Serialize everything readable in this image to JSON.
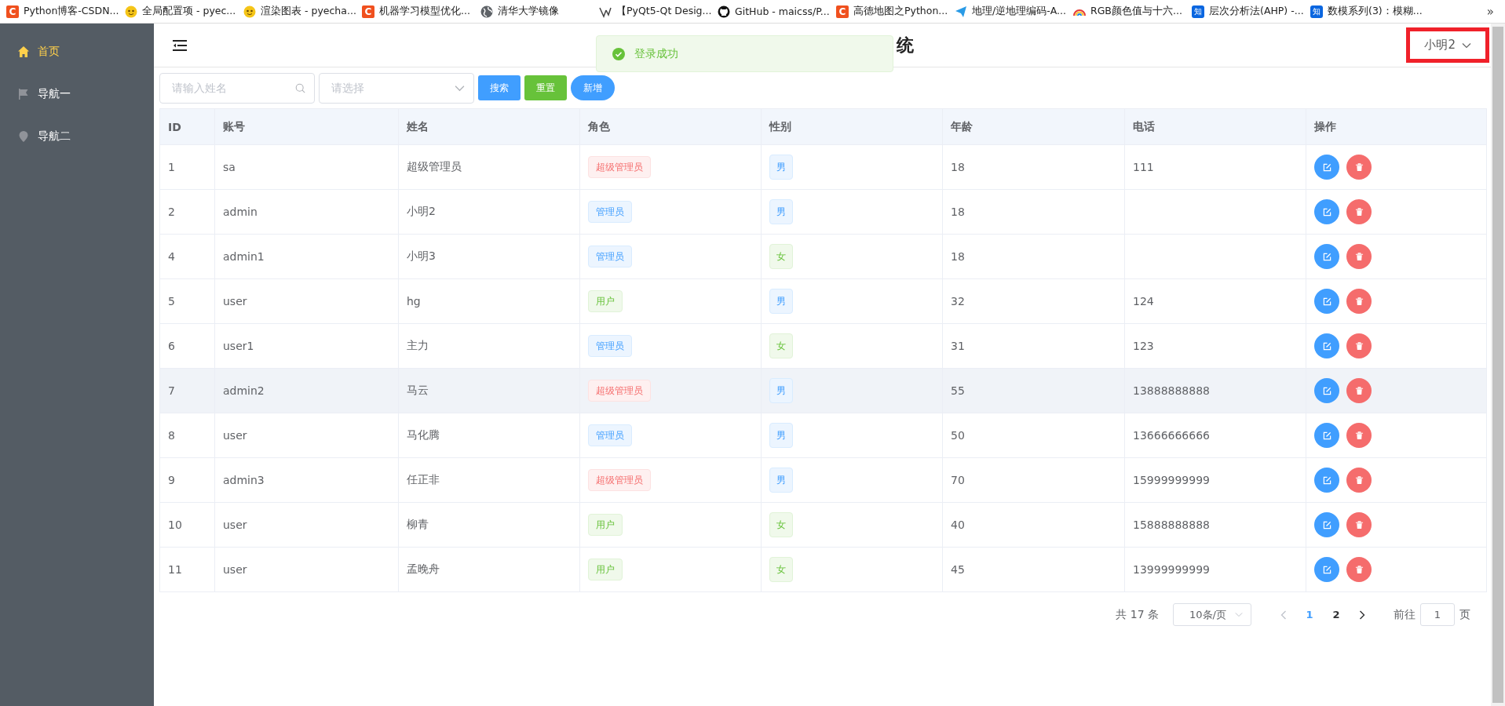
{
  "bookmarks": [
    {
      "kind": "letter",
      "icon_text": "C",
      "label": "Python博客-CSDN..."
    },
    {
      "kind": "smiley",
      "label": "全局配置项 - pyec..."
    },
    {
      "kind": "smiley",
      "label": "渲染图表 - pyecha..."
    },
    {
      "kind": "letter",
      "icon_text": "C",
      "label": "机器学习模型优化..."
    },
    {
      "kind": "globe",
      "label": "清华大学镜像"
    },
    {
      "kind": "mark",
      "label": "【PyQt5-Qt Desig..."
    },
    {
      "kind": "cat",
      "label": "GitHub - maicss/P..."
    },
    {
      "kind": "letter",
      "icon_text": "C",
      "label": "高德地图之Python..."
    },
    {
      "kind": "plane",
      "label": "地理/逆地理编码-A..."
    },
    {
      "kind": "rainbow",
      "label": "RGB颜色值与十六..."
    },
    {
      "kind": "square",
      "icon_text": "知",
      "label": "层次分析法(AHP) -..."
    },
    {
      "kind": "square",
      "icon_text": "知",
      "label": "数模系列(3)：模糊..."
    }
  ],
  "bookmarks_more": "»",
  "sidebar": {
    "items": [
      {
        "kind": "home",
        "label": "首页",
        "selected": true
      },
      {
        "kind": "flag",
        "label": "导航一",
        "selected": false
      },
      {
        "kind": "pin",
        "label": "导航二",
        "selected": false
      }
    ]
  },
  "header": {
    "title": "统",
    "user_menu": "小明2"
  },
  "toast": {
    "message": "登录成功"
  },
  "toolbar": {
    "search_placeholder": "请输入姓名",
    "select_placeholder": "请选择",
    "buttons": [
      {
        "label": "搜索",
        "kind": "primary"
      },
      {
        "label": "重置",
        "kind": "success"
      },
      {
        "label": "新增",
        "kind": "round"
      }
    ]
  },
  "table": {
    "columns": [
      "ID",
      "账号",
      "姓名",
      "角色",
      "性别",
      "年龄",
      "电话",
      "操作"
    ],
    "rows": [
      {
        "id": "1",
        "account": "sa",
        "name": "超级管理员",
        "role": {
          "text": "超级管理员",
          "kind": "danger"
        },
        "gender": {
          "text": "男",
          "kind": "primary"
        },
        "age": "18",
        "phone": "111",
        "highlighted": false
      },
      {
        "id": "2",
        "account": "admin",
        "name": "小明2",
        "role": {
          "text": "管理员",
          "kind": "primary"
        },
        "gender": {
          "text": "男",
          "kind": "primary"
        },
        "age": "18",
        "highlighted": false
      },
      {
        "id": "4",
        "account": "admin1",
        "name": "小明3",
        "role": {
          "text": "管理员",
          "kind": "primary"
        },
        "gender": {
          "text": "女",
          "kind": "success"
        },
        "age": "18",
        "highlighted": false
      },
      {
        "id": "5",
        "account": "user",
        "name": "hg",
        "role": {
          "text": "用户",
          "kind": "success"
        },
        "gender": {
          "text": "男",
          "kind": "primary"
        },
        "age": "32",
        "phone": "124",
        "highlighted": false
      },
      {
        "id": "6",
        "account": "user1",
        "name": "主力",
        "role": {
          "text": "管理员",
          "kind": "primary"
        },
        "gender": {
          "text": "女",
          "kind": "success"
        },
        "age": "31",
        "phone": "123",
        "highlighted": false
      },
      {
        "id": "7",
        "account": "admin2",
        "name": "马云",
        "role": {
          "text": "超级管理员",
          "kind": "danger"
        },
        "gender": {
          "text": "男",
          "kind": "primary"
        },
        "age": "55",
        "phone": "13888888888",
        "highlighted": true
      },
      {
        "id": "8",
        "account": "user",
        "name": "马化腾",
        "role": {
          "text": "管理员",
          "kind": "primary"
        },
        "gender": {
          "text": "男",
          "kind": "primary"
        },
        "age": "50",
        "phone": "13666666666",
        "highlighted": false
      },
      {
        "id": "9",
        "account": "admin3",
        "name": "任正非",
        "role": {
          "text": "超级管理员",
          "kind": "danger"
        },
        "gender": {
          "text": "男",
          "kind": "primary"
        },
        "age": "70",
        "phone": "15999999999",
        "highlighted": false
      },
      {
        "id": "10",
        "account": "user",
        "name": "柳青",
        "role": {
          "text": "用户",
          "kind": "success"
        },
        "gender": {
          "text": "女",
          "kind": "success"
        },
        "age": "40",
        "phone": "15888888888",
        "highlighted": false
      },
      {
        "id": "11",
        "account": "user",
        "name": "孟晚舟",
        "role": {
          "text": "用户",
          "kind": "success"
        },
        "gender": {
          "text": "女",
          "kind": "success"
        },
        "age": "45",
        "phone": "13999999999",
        "highlighted": false
      }
    ]
  },
  "pagination": {
    "total": "共 17 条",
    "page_size": "10条/页",
    "pages": [
      {
        "label": "1",
        "selected": true
      },
      {
        "label": "2",
        "selected": false
      }
    ],
    "jump_label": "前往",
    "jump_value": "1",
    "jump_suffix": "页"
  }
}
